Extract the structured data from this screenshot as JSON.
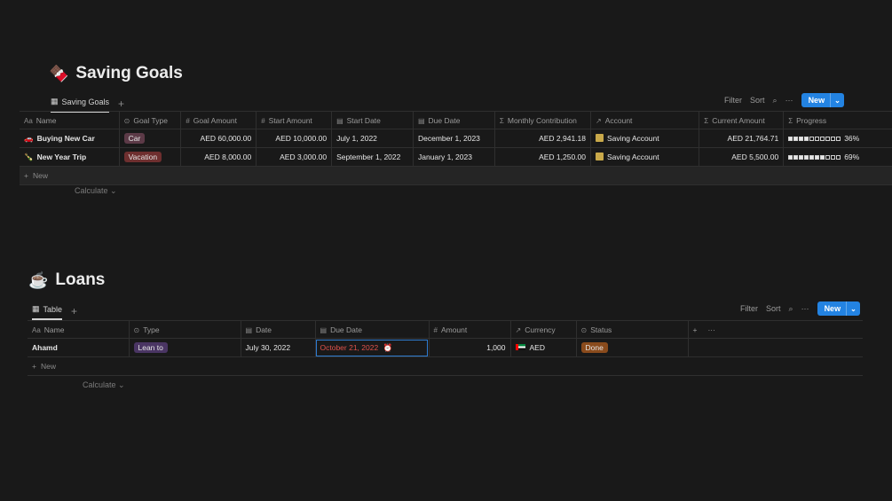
{
  "saving": {
    "emoji": "🍫",
    "title": "Saving Goals",
    "tab": "Saving Goals",
    "toolbar": {
      "filter": "Filter",
      "sort": "Sort",
      "new": "New"
    },
    "columns": [
      "Name",
      "Goal Type",
      "Goal Amount",
      "Start Amount",
      "Start Date",
      "Due Date",
      "Monthly Contribution",
      "Account",
      "Current Amount",
      "Progress"
    ],
    "rows": [
      {
        "icon": "🚗",
        "name": "Buying New Car",
        "type": "Car",
        "goal": "AED 60,000.00",
        "start_amount": "AED 10,000.00",
        "start_date": "July 1, 2022",
        "due": "December 1, 2023",
        "monthly": "AED 2,941.18",
        "account": "Saving Account",
        "current": "AED 21,764.71",
        "progress_fraction": 0.36,
        "progress": "36%"
      },
      {
        "icon": "🍾",
        "name": "New Year Trip",
        "type": "Vacation",
        "goal": "AED 8,000.00",
        "start_amount": "AED 3,000.00",
        "start_date": "September 1, 2022",
        "due": "January 1, 2023",
        "monthly": "AED 1,250.00",
        "account": "Saving Account",
        "current": "AED 5,500.00",
        "progress_fraction": 0.69,
        "progress": "69%"
      }
    ],
    "new_row": "New",
    "calculate": "Calculate"
  },
  "loans": {
    "emoji": "☕",
    "title": "Loans",
    "tab": "Table",
    "toolbar": {
      "filter": "Filter",
      "sort": "Sort",
      "new": "New"
    },
    "columns": [
      "Name",
      "Type",
      "Date",
      "Due Date",
      "Amount",
      "Currency",
      "Status"
    ],
    "rows": [
      {
        "name": "Ahamd",
        "type": "Lean to",
        "date": "July 30, 2022",
        "due": "October 21, 2022",
        "amount": "1,000",
        "currency": "AED",
        "status": "Done"
      }
    ],
    "new_row": "New",
    "calculate": "Calculate"
  },
  "colors": {
    "tag_car": "#5c3a47",
    "tag_vacation": "#6e2f2f",
    "tag_lean": "#4a3563",
    "tag_done": "#8a4b1c",
    "due_overdue": "#e0524a",
    "accent": "#2383e2"
  }
}
